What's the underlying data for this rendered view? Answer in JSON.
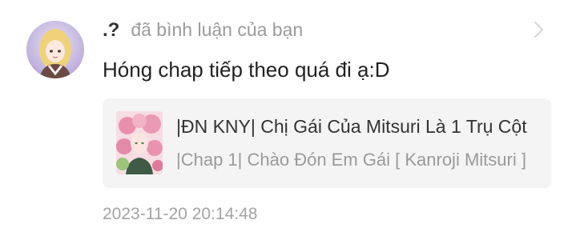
{
  "notification": {
    "user_name": ".?",
    "action": "đã bình luận của bạn",
    "comment": "Hóng chap tiếp theo quá đi ạ:D",
    "timestamp": "2023-11-20 20:14:48",
    "chevron_icon": "chevron-right-icon",
    "avatar_icon": "user-avatar"
  },
  "card": {
    "title": "|ĐN KNY| Chị Gái Của Mitsuri Là 1 Trụ Cột",
    "subtitle": "|Chap 1| Chào Đón Em Gái [ Kanroji Mitsuri ]",
    "thumbnail_icon": "story-cover-thumbnail"
  },
  "colors": {
    "card_background": "#f4f4f4",
    "muted_text": "#9b9b9b",
    "primary_text": "#222222"
  }
}
